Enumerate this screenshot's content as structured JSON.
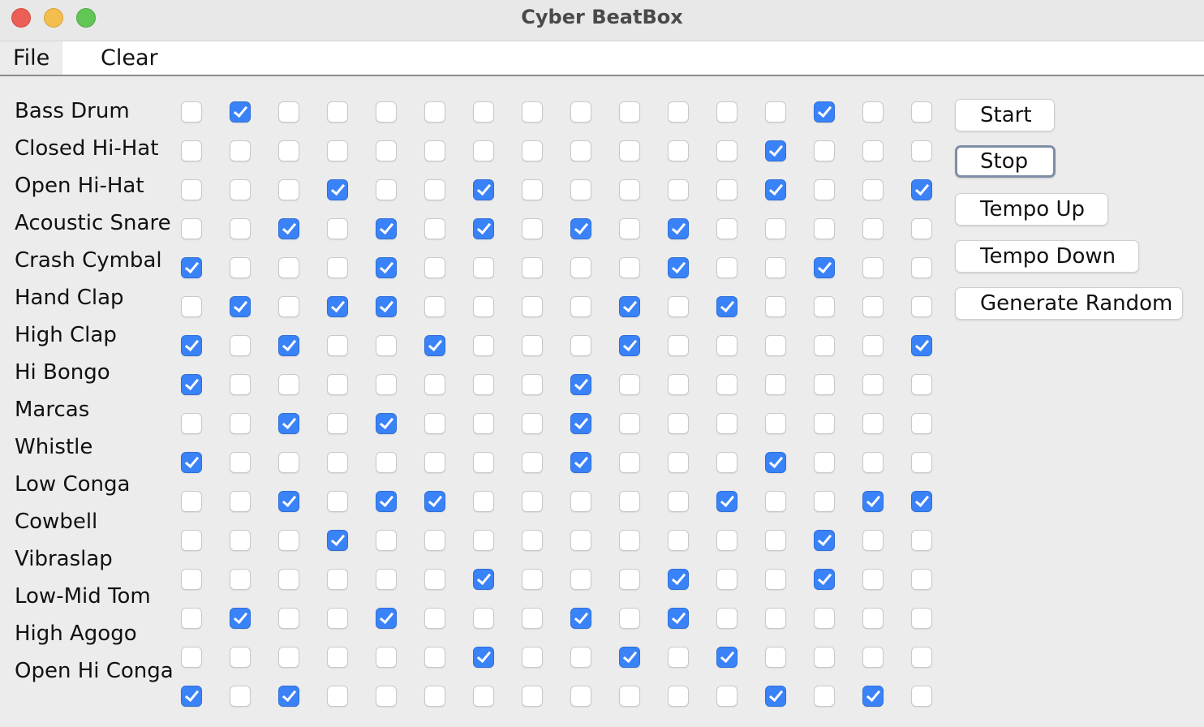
{
  "window": {
    "title": "Cyber BeatBox"
  },
  "menu": {
    "file": "File",
    "clear": "Clear"
  },
  "instruments": [
    "Bass Drum",
    "Closed Hi-Hat",
    "Open Hi-Hat",
    "Acoustic Snare",
    "Crash Cymbal",
    "Hand Clap",
    "High Clap",
    "Hi Bongo",
    "Marcas",
    "Whistle",
    "Low Conga",
    "Cowbell",
    "Vibraslap",
    "Low-Mid Tom",
    "High Agogo",
    "Open Hi Conga"
  ],
  "grid": [
    [
      0,
      1,
      0,
      0,
      0,
      0,
      0,
      0,
      0,
      0,
      0,
      0,
      0,
      1,
      0,
      0
    ],
    [
      0,
      0,
      0,
      0,
      0,
      0,
      0,
      0,
      0,
      0,
      0,
      0,
      1,
      0,
      0,
      0
    ],
    [
      0,
      0,
      0,
      1,
      0,
      0,
      1,
      0,
      0,
      0,
      0,
      0,
      1,
      0,
      0,
      1
    ],
    [
      0,
      0,
      1,
      0,
      1,
      0,
      1,
      0,
      1,
      0,
      1,
      0,
      0,
      0,
      0,
      0
    ],
    [
      1,
      0,
      0,
      0,
      1,
      0,
      0,
      0,
      0,
      0,
      1,
      0,
      0,
      1,
      0,
      0
    ],
    [
      0,
      1,
      0,
      1,
      1,
      0,
      0,
      0,
      0,
      1,
      0,
      1,
      0,
      0,
      0,
      0
    ],
    [
      1,
      0,
      1,
      0,
      0,
      1,
      0,
      0,
      0,
      1,
      0,
      0,
      0,
      0,
      0,
      1
    ],
    [
      1,
      0,
      0,
      0,
      0,
      0,
      0,
      0,
      1,
      0,
      0,
      0,
      0,
      0,
      0,
      0
    ],
    [
      0,
      0,
      1,
      0,
      1,
      0,
      0,
      0,
      1,
      0,
      0,
      0,
      0,
      0,
      0,
      0
    ],
    [
      1,
      0,
      0,
      0,
      0,
      0,
      0,
      0,
      1,
      0,
      0,
      0,
      1,
      0,
      0,
      0
    ],
    [
      0,
      0,
      1,
      0,
      1,
      1,
      0,
      0,
      0,
      0,
      0,
      1,
      0,
      0,
      1,
      1
    ],
    [
      0,
      0,
      0,
      1,
      0,
      0,
      0,
      0,
      0,
      0,
      0,
      0,
      0,
      1,
      0,
      0
    ],
    [
      0,
      0,
      0,
      0,
      0,
      0,
      1,
      0,
      0,
      0,
      1,
      0,
      0,
      1,
      0,
      0
    ],
    [
      0,
      1,
      0,
      0,
      1,
      0,
      0,
      0,
      1,
      0,
      1,
      0,
      0,
      0,
      0,
      0
    ],
    [
      0,
      0,
      0,
      0,
      0,
      0,
      1,
      0,
      0,
      1,
      0,
      1,
      0,
      0,
      0,
      0
    ],
    [
      1,
      0,
      1,
      0,
      0,
      0,
      0,
      0,
      0,
      0,
      0,
      0,
      1,
      0,
      1,
      0
    ]
  ],
  "buttons": {
    "start": "Start",
    "stop": "Stop",
    "tempo_up": "Tempo Up",
    "tempo_down": "Tempo Down",
    "generate_random": "Generate Random"
  },
  "colors": {
    "checked": "#3a82f7",
    "background": "#ececec"
  }
}
